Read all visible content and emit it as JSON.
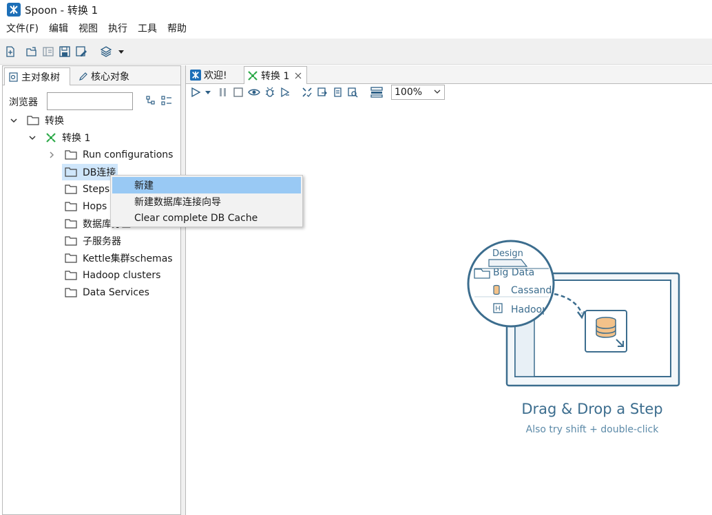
{
  "window": {
    "title": "Spoon - 转换 1",
    "app_icon": "spoon-logo-icon"
  },
  "menubar": {
    "items": [
      "文件(F)",
      "编辑",
      "视图",
      "执行",
      "工具",
      "帮助"
    ]
  },
  "toolbar": {
    "icons": [
      "new-file-icon",
      "open-folder-icon",
      "explore-repo-icon",
      "save-icon",
      "save-as-icon",
      "layers-icon",
      "dropdown-arrow-icon"
    ]
  },
  "left_pane": {
    "tabs": [
      {
        "label": "主对象树",
        "active": true
      },
      {
        "label": "核心对象",
        "active": false
      }
    ],
    "browse_label": "浏览器",
    "browse_value": "",
    "tree": {
      "root": "转换",
      "transformation": "转换 1",
      "children": [
        "Run configurations",
        "DB连接",
        "Steps",
        "Hops",
        "数据库分区schemas",
        "子服务器",
        "Kettle集群schemas",
        "Hadoop clusters",
        "Data Services"
      ]
    }
  },
  "right_pane": {
    "tabs": [
      {
        "label": "欢迎!",
        "active": false
      },
      {
        "label": "转换 1",
        "active": true,
        "closable": true
      }
    ],
    "zoom": "100%"
  },
  "context_menu": {
    "items": [
      "新建",
      "新建数据库连接向导",
      "Clear complete DB Cache"
    ],
    "highlighted_index": 0
  },
  "canvas": {
    "illustration": {
      "tab": "Design",
      "folder": "Big Data",
      "items": [
        "Cassandra",
        "Hadoop"
      ],
      "title": "Drag & Drop a Step",
      "subtitle": "Also try shift + double-click"
    }
  },
  "colors": {
    "accent": "#1d6fb8",
    "icon": "#2d5f86",
    "highlight": "#99c9f4",
    "green": "#2eaa4a",
    "illustration": "#3c6d8e"
  }
}
